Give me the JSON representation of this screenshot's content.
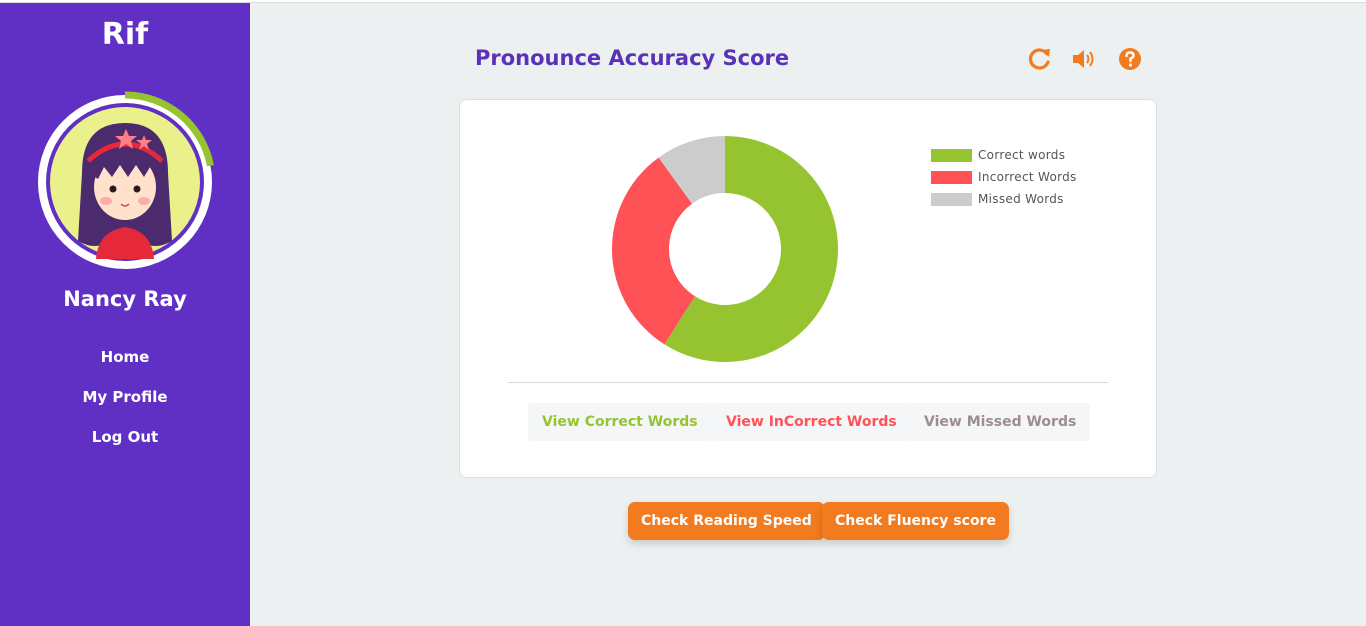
{
  "sidebar": {
    "brand": "Rif",
    "user_name": "Nancy Ray",
    "nav": [
      {
        "label": "Home"
      },
      {
        "label": "My Profile"
      },
      {
        "label": "Log Out"
      }
    ],
    "progress_ring_fraction": 0.22
  },
  "main": {
    "title": "Pronounce Accuracy Score",
    "tools": [
      {
        "icon": "refresh-icon"
      },
      {
        "icon": "volume-icon"
      },
      {
        "icon": "help-icon"
      }
    ]
  },
  "chart_data": {
    "type": "pie",
    "hole": true,
    "legend_position": "top-right",
    "labels": [
      "Correct words",
      "Incorrect Words",
      "Missed Words"
    ],
    "values": [
      59,
      31,
      10
    ],
    "colors": [
      "#96c431",
      "#ff5257",
      "#cccccc"
    ]
  },
  "buttons": {
    "view_correct": "View Correct Words",
    "view_incorrect": "View InCorrect Words",
    "view_missed": "View Missed Words",
    "check_speed": "Check Reading Speed",
    "check_fluency": "Check Fluency score"
  },
  "colors": {
    "sidebar": "#6030c4",
    "accent": "#f27a1f",
    "title": "#5a32b8",
    "correct": "#96c431",
    "incorrect": "#ff5257",
    "missed": "#9b8e8e"
  }
}
